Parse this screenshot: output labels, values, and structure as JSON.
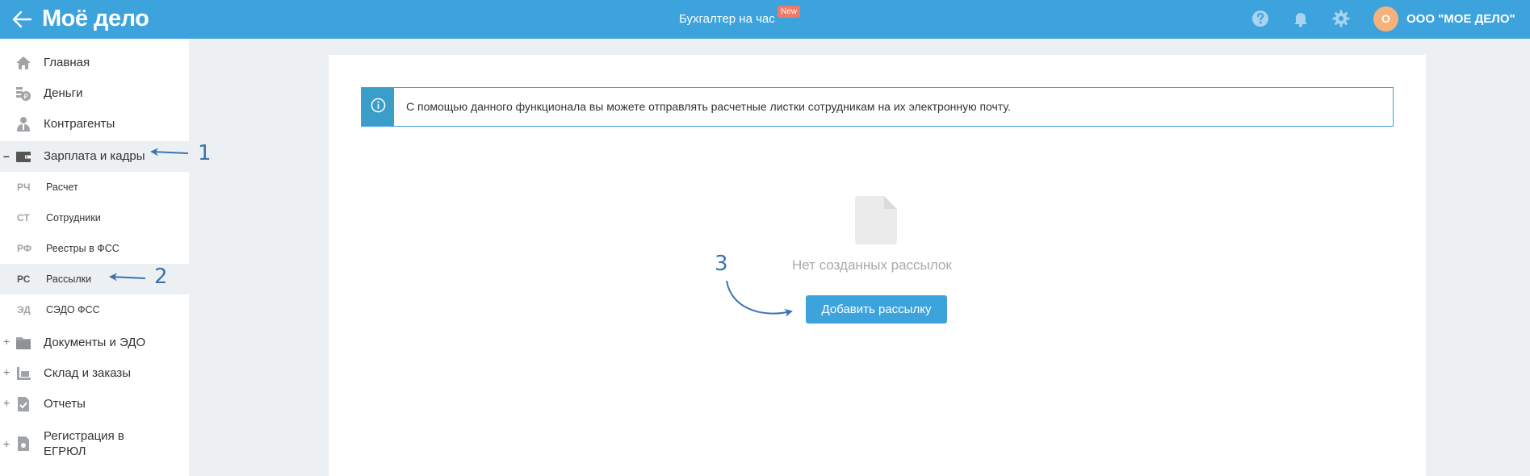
{
  "header": {
    "logo": "Моё дело",
    "center_link": "Бухгалтер на час",
    "new_badge": "New",
    "avatar_letter": "О",
    "org_name": "ООО \"МОЕ ДЕЛО\"",
    "brand_color": "#3da3dd",
    "icons": [
      "back-arrow-icon",
      "help-icon",
      "bell-icon",
      "gear-icon"
    ]
  },
  "sidebar": {
    "items": [
      {
        "label": "Главная",
        "icon": "home-icon"
      },
      {
        "label": "Деньги",
        "icon": "money-icon"
      },
      {
        "label": "Контрагенты",
        "icon": "contractor-icon"
      },
      {
        "label": "Зарплата и кадры",
        "icon": "wallet-icon",
        "expander": "–"
      },
      {
        "label": "Документы и ЭДО",
        "icon": "folder-icon",
        "expander": "+"
      },
      {
        "label": "Склад и заказы",
        "icon": "warehouse-icon",
        "expander": "+"
      },
      {
        "label": "Отчеты",
        "icon": "report-icon",
        "expander": "+"
      },
      {
        "label": "Регистрация в ЕГРЮЛ",
        "icon": "registration-icon",
        "expander": "+"
      }
    ],
    "subitems": [
      {
        "abbr": "РЧ",
        "label": "Расчет"
      },
      {
        "abbr": "СТ",
        "label": "Сотрудники"
      },
      {
        "abbr": "РФ",
        "label": "Реестры в ФСС"
      },
      {
        "abbr": "РС",
        "label": "Рассылки"
      },
      {
        "abbr": "ЭД",
        "label": "СЭДО ФСС"
      }
    ]
  },
  "main": {
    "info_text": "С помощью данного функционала вы можете отправлять расчетные листки сотрудникам на их электронную почту.",
    "empty_text": "Нет созданных рассылок",
    "add_button": "Добавить рассылку"
  },
  "annotations": {
    "n1": "1",
    "n2": "2",
    "n3": "3"
  }
}
